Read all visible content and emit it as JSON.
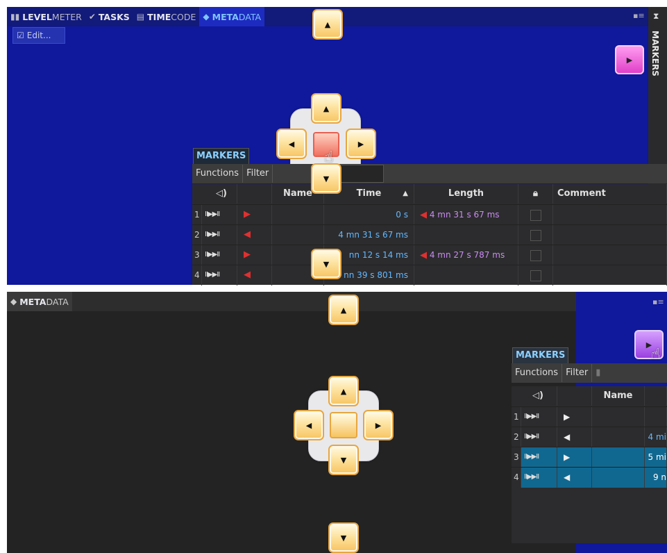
{
  "top_panel": {
    "tabs": [
      {
        "icon": "levelmeter-icon",
        "bold": "LEVEL",
        "rest": "METER"
      },
      {
        "icon": "check-icon",
        "bold": "TASKS",
        "rest": ""
      },
      {
        "icon": "timecode-icon",
        "bold": "TIME",
        "rest": "CODE"
      },
      {
        "icon": "tag-icon",
        "bold": "META",
        "rest": "DATA"
      }
    ],
    "edit_label": "Edit...",
    "side_tab_label": "MARKERS"
  },
  "bottom_panel": {
    "tab": {
      "bold": "META",
      "rest": "DATA"
    }
  },
  "markers": {
    "title": "MARKERS",
    "toolbar": [
      "Functions",
      "Filter"
    ],
    "columns": [
      "Name",
      "Time",
      "Length",
      "Comment"
    ],
    "rows": [
      {
        "num": "1",
        "dir": "right",
        "time": "0 s",
        "length": "4 mn 31 s 67 ms"
      },
      {
        "num": "2",
        "dir": "left",
        "time": "4 mn 31 s 67 ms",
        "length": ""
      },
      {
        "num": "3",
        "dir": "right",
        "time": "nn 12 s 14 ms",
        "length": "4 mn 27 s 787 ms"
      },
      {
        "num": "4",
        "dir": "left",
        "time": "nn 39 s 801 ms",
        "length": ""
      }
    ],
    "bottom_rows": [
      {
        "num": "1",
        "dir": "right",
        "time": ""
      },
      {
        "num": "2",
        "dir": "left",
        "time": "4 mi"
      },
      {
        "num": "3",
        "dir": "right",
        "time": "5 mi"
      },
      {
        "num": "4",
        "dir": "left",
        "time": "9 n"
      }
    ]
  },
  "colors": {
    "panel_blue": "#10189c",
    "tab_active": "#7fc4ff",
    "dock_orange": "#f7c460",
    "side_button_pink": "#e040c8",
    "side_button_purple": "#9a40e0"
  }
}
